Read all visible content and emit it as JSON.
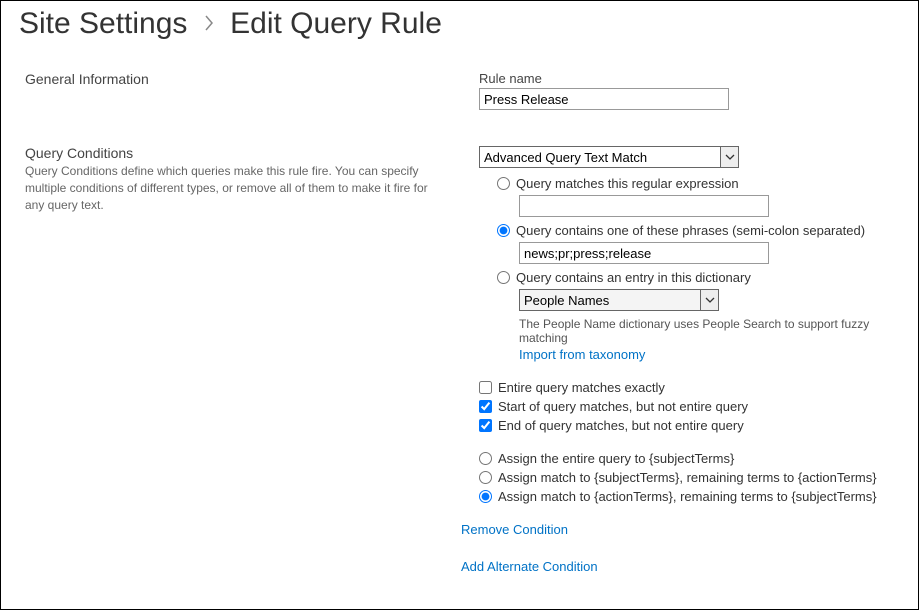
{
  "breadcrumb": {
    "parent": "Site Settings",
    "current": "Edit Query Rule"
  },
  "sections": {
    "general": {
      "title": "General Information",
      "rule_name_label": "Rule name",
      "rule_name_value": "Press Release"
    },
    "conditions": {
      "title": "Query Conditions",
      "description": "Query Conditions define which queries make this rule fire. You can specify multiple conditions of different types, or remove all of them to make it fire for any query text.",
      "match_type_value": "Advanced Query Text Match",
      "opt_regex": "Query matches this regular expression",
      "regex_value": "",
      "opt_phrases": "Query contains one of these phrases (semi-colon separated)",
      "phrases_value": "news;pr;press;release",
      "opt_dict": "Query contains an entry in this dictionary",
      "dict_value": "People Names",
      "dict_note": "The People Name dictionary uses People Search to support fuzzy matching",
      "import_link": "Import from taxonomy",
      "chk_entire": "Entire query matches exactly",
      "chk_start": "Start of query matches, but not entire query",
      "chk_end": "End of query matches, but not entire query",
      "assign_entire": "Assign the entire query to {subjectTerms}",
      "assign_subject": "Assign match to {subjectTerms}, remaining terms to {actionTerms}",
      "assign_action": "Assign match to {actionTerms}, remaining terms to {subjectTerms}",
      "remove_link": "Remove Condition",
      "add_link": "Add Alternate Condition"
    }
  }
}
